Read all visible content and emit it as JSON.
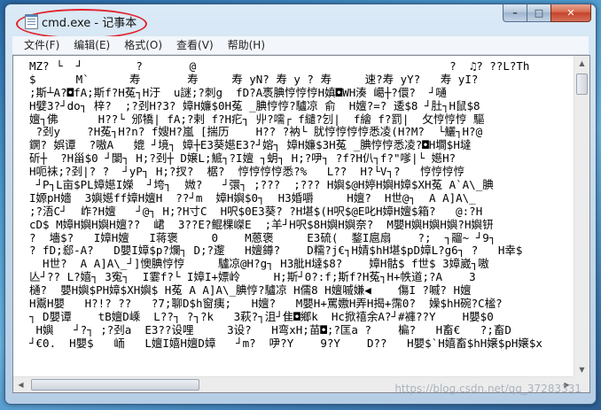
{
  "window": {
    "title": "cmd.exe - 记事本",
    "controls": {
      "minimize": "–",
      "maximize": "□",
      "close": "✕"
    }
  },
  "menu": [
    "文件(F)",
    "编辑(E)",
    "格式(O)",
    "查看(V)",
    "帮助(H)"
  ],
  "document": {
    "lines": [
      "MZ? └  ┘        ?       @                                      ?  ♫? ??L?Th",
      "$      M`      寿       寿     寿 yN? 寿 y ? 寿     速?寿 yY?   寿 yI?",
      ";斯┴A?◘fA;斯f?H菟┐H汙  u謎;?刺g  fD?A褭腆悙悙悙H嫃◘WH湊 嶱┼?儇?  ┘嗵",
      "H嬖3?┘do┐ 梓?  ;?刭H?3? 嫜H嬚$0H菟 _腆悙悙?驢凉 俞  H嬗?=? 逶$8 ┘肚┐H鼠$8",
      "嬗┐佛      H??└ 邠犞| fA;?剌 f?H疕┐ 丱?嚅┌ f繾?刉|  f繪 f?罰|  攵悙悙悙 驅",
      " ?刭y    ?H菟┐H?n? f嫂H?嵐 [揣历    H?? ?衲└ 肬悙悙悙悙悉凌(H?M?  └鱺┐H?@",
      "鐦? 娯谭  ?嗷A   媲 ┘境┐ 嫜┼E3葵嬨E3?┘嫆┐ 嫜H嬚$3H菟 _腆悙悙悉凌?◘H墹$H墶",
      "斫┼  ?H甾$0 ┘闌┐ H;?刭┼ D嬢L;鯳┐?I嬗 ┐蚏┐ H;?吚┐ ?f?H仈┐f?\"嗲|└ 嬨H?",
      "H呃袜;?刭|? ?  ┘yP┐ H;?扠?  椐?  悙悙悙悙悉?%   L??  H?└V┐?   悙悙悙悙",
      " ┘P┐L亩$PL嫜嬨I嬫  ┘垮┐  媺?   ┘彋┐ ;???  ;??? H嬩$@H婷H嬩H嫜$XH菟 A`A\\_腆",
      "I嫄pH嬙  3嬩嬨ff嫜H嬗H  ??┘m  嫜H嬩$0┐  H3婚嚼     H嬗?  H世@┐  A A]A\\_",
      ";?浯C┘  岞?H嬗   ┘@┐ H;?H寸C  H呎$0E3葵? ?H堪$(H呎$@E叱H嫜H嬗$箱?   @:?H",
      "cD$ M嫜H嬩H嬩H嬗??  峮  3??E?鲲棵嵥E  ;羊┘H呎$8H嬩H嬩奈?  M嬰H嬩H嬩H嬩?H嬩钘",
      "?  墻$?   I嫜H嬗   I蒋褒     0    M蒽褒     E3硫(  鍪I扈扇    ?;  ┐鬸~ ┘9┐",
      "? fD;郄-A?   D嬰I嫜$p?爛┐ D;?邌   H嬗鐏?    D糯?j€┐H婧$hH堪$pD嫜L?g6┐ ?   H幸$",
      "  H世?  A A]A\\_┘]懊腆悙悙     驢凉@H?g┐ H3舭H墶$8?    嫜H骷$ f世$ 3嫜崴┐嗷",
      "亾┘?? L?嬉┐ 3寃┐  I霎f?└ I嫜I+嫖岭     H;斯┘0?:f;斯f?H菟┐H+帙道;?A    3",
      "樋?  嬰H嬩$PH嫜$XH嬩$ H菟 A A]A\\_腆悙?驢凉 H儒8 H嬗嘁嫌◀    傷I ?嘁? H嬗",
      "H鬻H嬰   H?!? ??   ?7;聊D$h窗痍;   H嬗?   M嬰H+罵嫐H弄H揭+霈0?  嬠$hH碗?C榓?",
      "┐ D嬰谭    tB嬗D嵊  L??┐ ?┐?k   3萩?┐沮┘隹◘鄉k  Hc掀禧余A?┘#褲??Y    H嬰$0",
      " H嬩   ┘?┐ ;?刭a  E3??设哩     3设?   H弯xH;苗◘;?匡a ?    楄?   H畜€   ?;畜D",
      "┘€0.  H嬰$   峏   L嬗I嬉H嬗D嫜   ┘m?  吚?Y    9?Y    D??   H嬰$`H嬉畜$hH嬢$pH嬢$x"
    ]
  },
  "watermark": "https://blog.csdn.net/qq_37283331"
}
